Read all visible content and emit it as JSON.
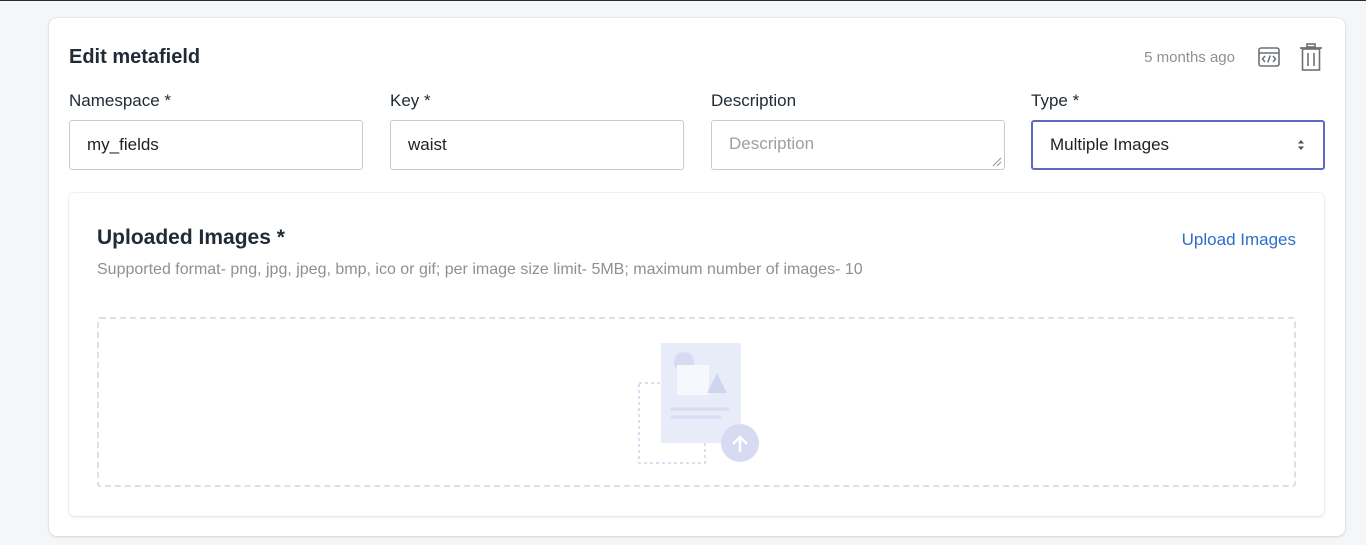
{
  "card": {
    "title": "Edit metafield",
    "timestamp": "5 months ago",
    "icons": {
      "code": "code-icon",
      "delete": "trash-icon"
    }
  },
  "fields": {
    "namespace": {
      "label": "Namespace *",
      "value": "my_fields"
    },
    "key": {
      "label": "Key *",
      "value": "waist"
    },
    "description": {
      "label": "Description",
      "value": "",
      "placeholder": "Description"
    },
    "type": {
      "label": "Type *",
      "value": "Multiple Images"
    }
  },
  "upload": {
    "title": "Uploaded Images *",
    "link_label": "Upload Images",
    "hint": "Supported format- png, jpg, jpeg, bmp, ico or gif; per image size limit- 5MB; maximum number of images- 10",
    "dropzone_icon": "image-upload-icon"
  },
  "colors": {
    "accent": "#5c6ac4",
    "link": "#2c6ecb",
    "muted_text": "#8c9196"
  }
}
